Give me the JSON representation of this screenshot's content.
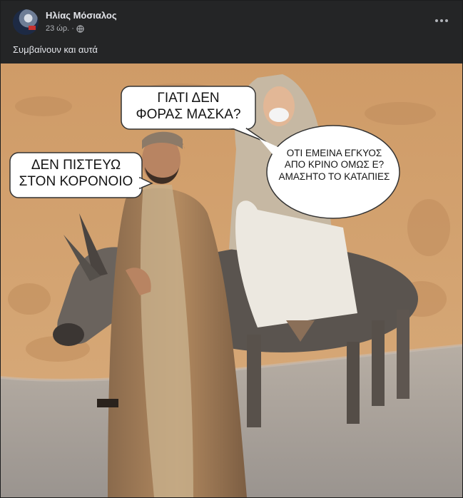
{
  "post": {
    "author": "Ηλίας Μόσιαλος",
    "time": "23 ώρ.",
    "separator": "·",
    "privacy_icon": "globe-icon",
    "more_icon": "more-options-icon",
    "caption": "Συμβαίνουν και αυτά"
  },
  "meme": {
    "bubble_joseph": {
      "line1": "ΔΕΝ ΠΙΣΤΕΥΩ",
      "line2": "ΣΤΟΝ ΚΟΡΟΝΟΙΟ"
    },
    "bubble_question": {
      "line1": "ΓΙΑΤΙ ΔΕΝ",
      "line2": "ΦΟΡΑΣ ΜΑΣΚΑ?"
    },
    "bubble_mary": {
      "line1": "ΟΤΙ ΕΜΕΙΝΑ ΕΓΚΥΟΣ",
      "line2": "ΑΠΟ ΚΡΙΝΟ ΟΜΩΣ Ε?",
      "line3": "ΑΜΑΣΗΤΟ ΤΟ ΚΑΤΑΠΙΕΣ"
    }
  },
  "colors": {
    "post_bg": "#242526",
    "text_primary": "#e4e6eb",
    "text_secondary": "#b0b3b8",
    "wall": "#d3a16e",
    "road": "#a6a09b"
  }
}
